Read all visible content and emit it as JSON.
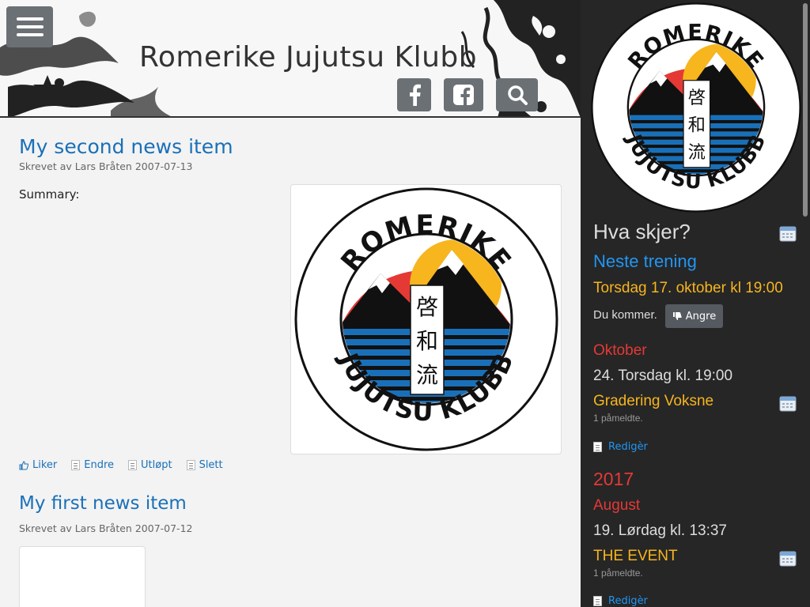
{
  "header": {
    "title": "Romerike Jujutsu Klubb",
    "logo_text_top": "ROMERIKE",
    "logo_text_bottom": "JUJUTSU KLUBB",
    "logo_kanji": [
      "啓",
      "和",
      "流"
    ]
  },
  "news": [
    {
      "title": "My second news item",
      "byline": "Skrevet av Lars Bråten 2007-07-13",
      "summary_label": "Summary:",
      "actions": [
        "Liker",
        "Endre",
        "Utløpt",
        "Slett"
      ]
    },
    {
      "title": "My first news item",
      "byline": "Skrevet av Lars Bråten 2007-07-12"
    }
  ],
  "sidebar": {
    "heading": "Hva skjer?",
    "next_training_label": "Neste trening",
    "next_training_date": "Torsdag 17. oktober kl 19:00",
    "attending_text": "Du kommer.",
    "undo_button": "Angre",
    "month1": "Oktober",
    "event1_date": "24. Torsdag kl. 19:00",
    "event1_title": "Gradering Voksne",
    "event1_count": "1 påmeldte.",
    "edit_label": "Redigèr",
    "year": "2017",
    "month2": "August",
    "event2_date": "19. Lørdag kl. 13:37",
    "event2_title": "THE EVENT",
    "event2_count": "1 påmeldte.",
    "edit_label2": "Redigèr"
  },
  "colors": {
    "link_blue": "#1a70b8",
    "sidebar_blue": "#2196f3",
    "orange": "#f7b51e",
    "red": "#e53935",
    "sidebar_bg": "#262626"
  }
}
